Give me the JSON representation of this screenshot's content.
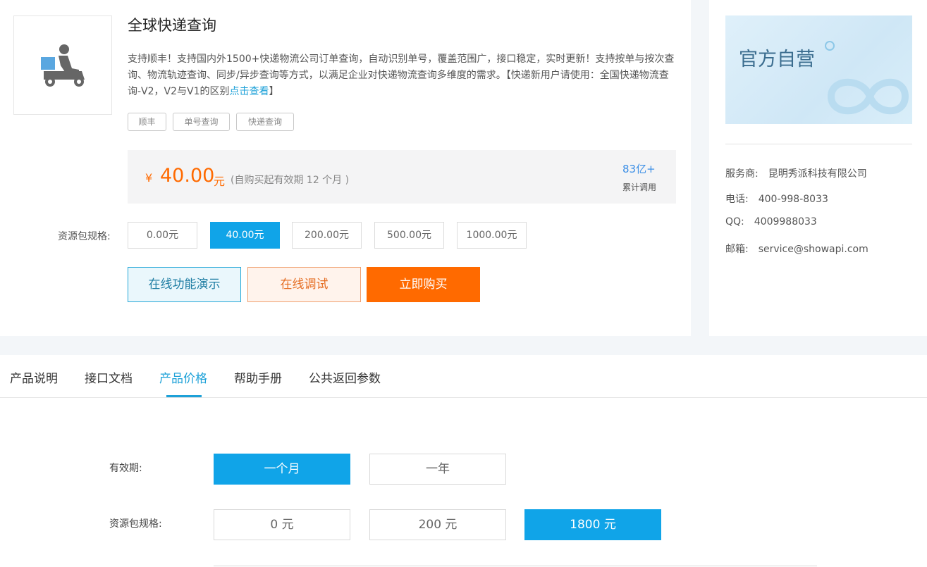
{
  "product": {
    "title": "全球快递查询",
    "description": "支持顺丰！支持国内外1500+快递物流公司订单查询，自动识别单号，覆盖范围广，接口稳定，实时更新！支持按单与按次查询、物流轨迹查询、同步/异步查询等方式，以满足企业对快递物流查询多维度的需求。【快递新用户请使用：全国快递物流查询-V2，V2与V1的区别",
    "description_link": "点击查看",
    "description_tail": "】",
    "tags": [
      "顺丰",
      "单号查询",
      "快递查询"
    ],
    "icon": "delivery-scooter-icon"
  },
  "pricing": {
    "currency": "¥",
    "price": "40.00",
    "unit": "元",
    "validity": "(自购买起有效期 12 个月 )",
    "calls_count": "83亿+",
    "calls_label": "累计调用"
  },
  "package": {
    "label": "资源包规格:",
    "options": [
      "0.00元",
      "40.00元",
      "200.00元",
      "500.00元",
      "1000.00元"
    ],
    "selected": "40.00元"
  },
  "actions": {
    "demo": "在线功能演示",
    "debug": "在线调试",
    "buy": "立即购买"
  },
  "provider": {
    "banner_text": "官方自营",
    "service_label": "服务商:",
    "service_value": "昆明秀派科技有限公司",
    "phone_label": "电话:",
    "phone_value": "400-998-8033",
    "qq_label": "QQ:",
    "qq_value": "4009988033",
    "email_label": "邮箱:",
    "email_value": "service@showapi.com"
  },
  "tabs": [
    "产品说明",
    "接口文档",
    "产品价格",
    "帮助手册",
    "公共返回参数"
  ],
  "active_tab": "产品价格",
  "price_panel": {
    "period_label": "有效期:",
    "periods": [
      "一个月",
      "一年"
    ],
    "selected_period": "一个月",
    "spec_label": "资源包规格:",
    "specs": [
      "0 元",
      "200 元",
      "1800 元"
    ],
    "selected_spec": "1800 元"
  },
  "colors": {
    "accent_blue": "#10a4e8",
    "price_orange": "#ff6a00",
    "link_blue": "#1da1d8"
  }
}
